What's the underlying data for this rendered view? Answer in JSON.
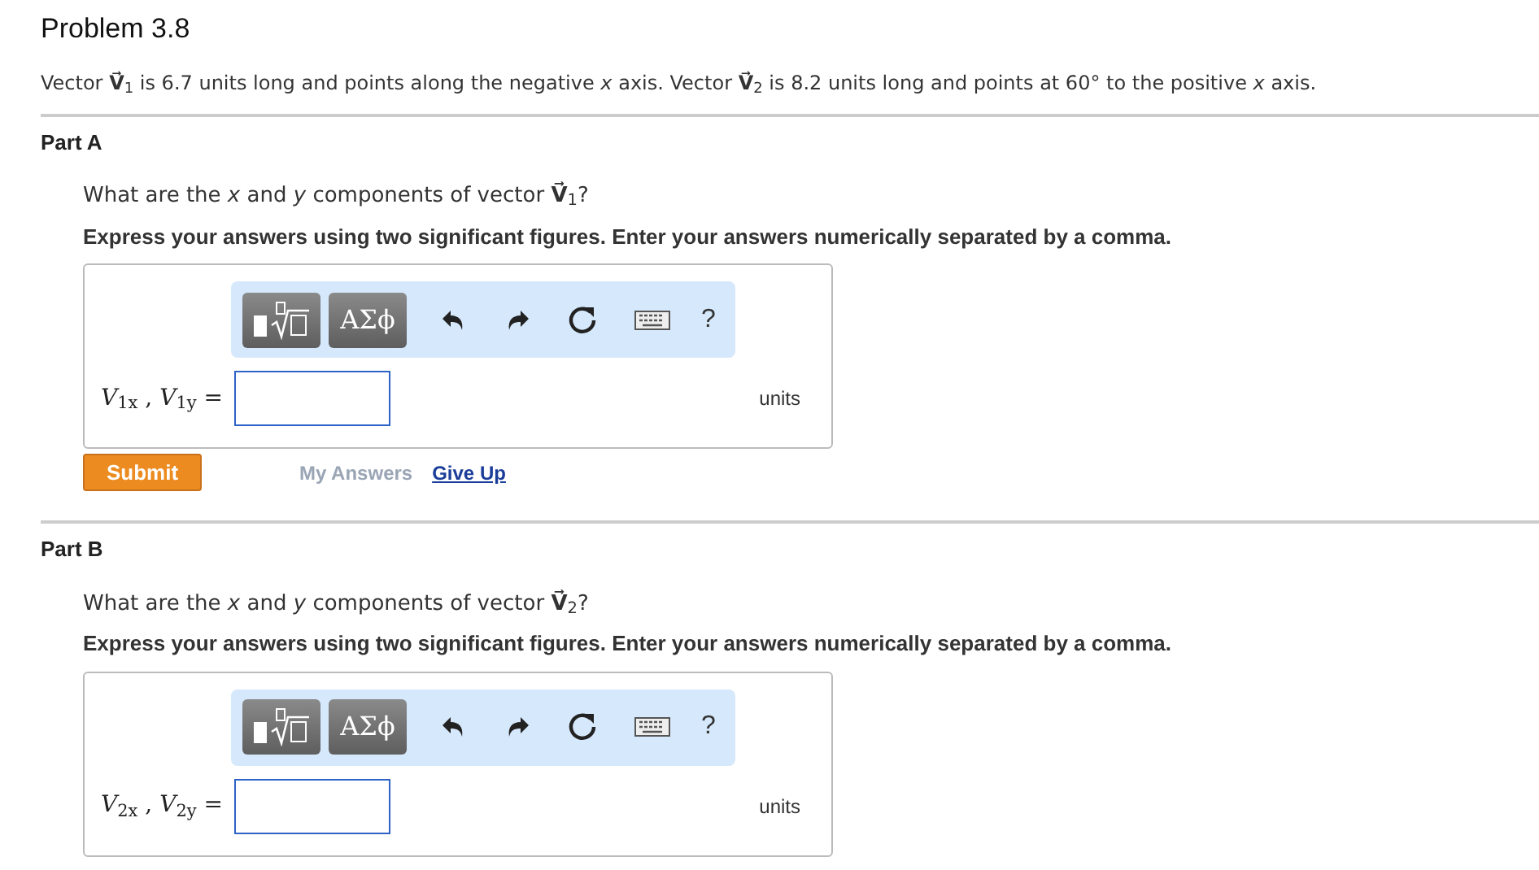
{
  "title": "Problem 3.8",
  "intro": "Vector **V⃗**$_{1}$ is 6.7 units long and points along the negative *x* axis. Vector **V⃗**$_{2}$ is 8.2 units long and points at 60° to the positive *x* axis.",
  "parts": [
    {
      "heading": "Part A",
      "question": "What are the *x* and *y* components of vector **V⃗**$_{1}$?",
      "instructions": "Express your answers using two significant figures. Enter your answers numerically separated by a comma.",
      "toolbar": {
        "symbols": "ΑΣϕ",
        "help": "?"
      },
      "label": "*V*$_{1x}$ , *V*$_{1y}$ =",
      "units": "units",
      "submit": "Submit",
      "links": [
        {
          "text": "My Answers",
          "disabled": true
        },
        {
          "text": "Give Up",
          "disabled": false
        }
      ]
    },
    {
      "heading": "Part B",
      "question": "What are the *x* and *y* components of vector **V⃗**$_{2}$?",
      "instructions": "Express your answers using two significant figures. Enter your answers numerically separated by a comma.",
      "toolbar": {
        "symbols": "ΑΣϕ",
        "help": "?"
      },
      "label": "*V*$_{2x}$ , *V*$_{2y}$ =",
      "units": "units"
    }
  ]
}
